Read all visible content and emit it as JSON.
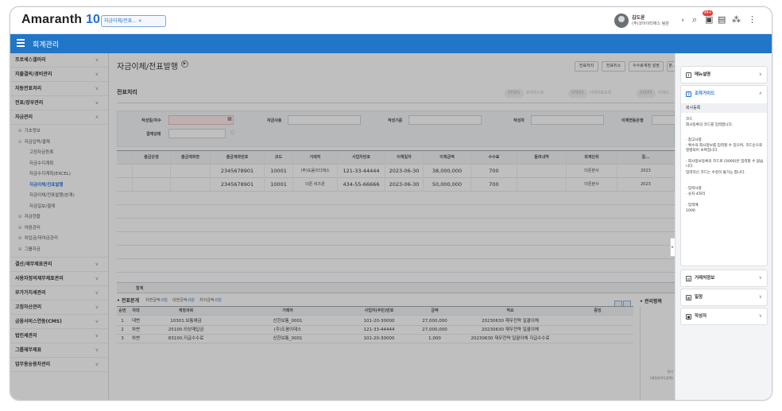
{
  "app": {
    "logo_text": "Amaranth",
    "logo_num": "10",
    "doc_tab": "자금이체/전표... ×",
    "module_title": "회계관리",
    "brand_color": "#2176c7",
    "user": {
      "name": "김도윤",
      "org": "(주)코아이티에스 팀원",
      "chev": "∨"
    },
    "notif_badge": "99+",
    "icons": {
      "search": "⌕",
      "notify": "▣",
      "calendar": "▤",
      "org": "⁂",
      "more": "⋮"
    }
  },
  "leftnav": {
    "items_top": [
      {
        "label": "프로세스갤러리",
        "chev": "∨"
      },
      {
        "label": "자출결의/경비관리",
        "chev": "∨"
      },
      {
        "label": "자동전표처리",
        "chev": "∨"
      },
      {
        "label": "전표/장부관리",
        "chev": "∨"
      },
      {
        "label": "자금관리",
        "chev": "∧"
      }
    ],
    "sub": [
      {
        "mk": "⊞",
        "label": "기초정보",
        "level": 1
      },
      {
        "mk": "⊟",
        "label": "자금입력/결재",
        "level": 1
      },
      {
        "mk": "",
        "label": "고정자금등록",
        "level": 2
      },
      {
        "mk": "",
        "label": "자금수지계획",
        "level": 2
      },
      {
        "mk": "",
        "label": "자금수지계획(EXCEL)",
        "level": 2
      },
      {
        "mk": "",
        "label": "자금이체/전표발행",
        "level": 2,
        "active": true
      },
      {
        "mk": "",
        "label": "자금이체/전표발행(본계)",
        "level": 2
      },
      {
        "mk": "",
        "label": "자금일보/결재",
        "level": 2
      },
      {
        "mk": "⊞",
        "label": "자금현황",
        "level": 1
      },
      {
        "mk": "⊞",
        "label": "어음관리",
        "level": 1
      },
      {
        "mk": "⊞",
        "label": "차입금/대여금관리",
        "level": 1
      },
      {
        "mk": "⊞",
        "label": "그룹자금",
        "level": 1
      }
    ],
    "items_bottom": [
      {
        "label": "결산/재무제표관리",
        "chev": "∨"
      },
      {
        "label": "사용자정의재무제표관리",
        "chev": "∨"
      },
      {
        "label": "부가가치세관리",
        "chev": "∨"
      },
      {
        "label": "고정자산관리",
        "chev": "∨"
      },
      {
        "label": "금융서비스연동(CMS)",
        "chev": "∨"
      },
      {
        "label": "법인세관리",
        "chev": "∨"
      },
      {
        "label": "그룹재무제표",
        "chev": "∨"
      },
      {
        "label": "업무용승용차관리",
        "chev": "∨"
      }
    ]
  },
  "main": {
    "title": "자금이체/전표발행",
    "title_icon": "▶",
    "toolbar": [
      "전표처리",
      "전표취소",
      "수수료계정 설정",
      "분..."
    ],
    "section_title": "전표처리",
    "steps": [
      {
        "num": "STEP1",
        "label": "요약리스트"
      },
      {
        "num": "STEP2",
        "label": "이체자료조회"
      },
      {
        "num": "STEP3",
        "label": "이체자..."
      }
    ],
    "search": {
      "date_label": "작성일/자수",
      "status_label": "결재상태",
      "purpose_label": "자금사용",
      "criteria_label": "작성기준",
      "writer_label": "작성자",
      "bank_label": "이체연동은행",
      "cal_icon": "▦"
    },
    "grid": {
      "headers": [
        "",
        "출금은행",
        "출금계좌명",
        "출금계좌번호",
        "코드",
        "거래처",
        "사업자번호",
        "이체일자",
        "이체금액",
        "수수료",
        "돌려내역",
        "회계단위",
        "결..."
      ],
      "rows": [
        [
          "",
          "",
          "",
          "2345678901",
          "10001",
          "(주)도움이디에스",
          "121-33-44444",
          "2023-06-30",
          "38,000,000",
          "700",
          "",
          "더존본사",
          "2023"
        ],
        [
          "",
          "",
          "",
          "2345678901",
          "10001",
          "더존 비즈온",
          "434-55-66666",
          "2023-06-30",
          "50,000,000",
          "700",
          "",
          "더존본사",
          "2023"
        ]
      ],
      "total_label": "합계"
    },
    "lower": {
      "title": "• 전표분개",
      "debit_label": "차변금액:",
      "debit_val": "0원",
      "credit_label": "대변금액:",
      "credit_val": "0원",
      "diff_label": "차이금액:",
      "diff_val": "0원",
      "headers": [
        "순번",
        "차대",
        "계정과목",
        "거래처",
        "사업자(주민)번호",
        "금액",
        "적요",
        "증빙"
      ],
      "rows": [
        [
          "1",
          "대변",
          "10301.보통예금",
          "신한보통_0001",
          "101-20-30000",
          "27,000,000",
          "20230630 재무전략 일괄이체",
          ""
        ],
        [
          "2",
          "차변",
          "25100.외상매입금",
          "(주)도움이데스",
          "121-33-44444",
          "27,000,000",
          "20230630 재무전략 일괄이체",
          ""
        ],
        [
          "3",
          "차변",
          "83100.지급수수료",
          "신한보통_0001",
          "101-20-30000",
          "1,000",
          "20230630 재무전략 일괄이체 지급수수료",
          ""
        ]
      ],
      "mgmt_title": "• 관리항목",
      "mgmt_text1": "관리",
      "mgmt_text2": "[계정과목도움택)"
    },
    "collapse_icon": "▸"
  },
  "rightpanel": {
    "menu_desc": {
      "label": "메뉴설명",
      "icon": "i",
      "chev": "∨"
    },
    "guide": {
      "label": "조작가이드",
      "icon": "?",
      "chev": "∧",
      "sub": "회사등록",
      "code_title": "코드",
      "code_text": "회사등록의 코드를 입력합니다.",
      "ref_title": "· 참고사항",
      "ref1": "· 복수의 회사정보를 입력할 수 있으며, 코드순으로 정렬되어 보여집니다.",
      "ref2": "· 회사정보등록의 코드로 [0000]은 입력할 수 없습니다.",
      "ref3": "입력하신 코드는 수정이 불가능 합니다.",
      "input_title": "· 입력사항",
      "input_text": "· 숫자 4자리",
      "example_title": "· 입력예",
      "example_text": "1000"
    },
    "partner": {
      "label": "거래처정보",
      "icon": "▤",
      "chev": "∨"
    },
    "budget": {
      "label": "일정",
      "icon": "▦",
      "chev": "∨"
    },
    "writer": {
      "label": "작성자",
      "icon": "■",
      "chev": "∨"
    }
  }
}
